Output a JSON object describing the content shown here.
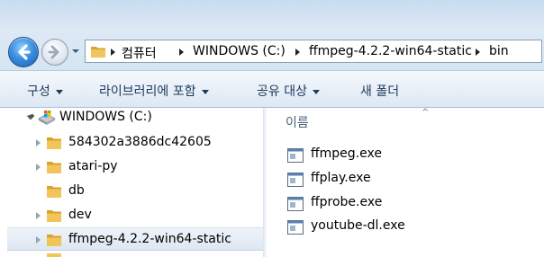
{
  "address_bar": {
    "breadcrumbs": [
      {
        "label": "컴퓨터"
      },
      {
        "label": "WINDOWS (C:)"
      },
      {
        "label": "ffmpeg-4.2.2-win64-static"
      },
      {
        "label": "bin"
      }
    ]
  },
  "command_bar": {
    "organize": "구성",
    "library": "라이브러리에 포함",
    "share": "공유 대상",
    "new_folder": "새 폴더"
  },
  "tree": {
    "drive": "WINDOWS (C:)",
    "items": [
      {
        "label": "584302a3886dc42605"
      },
      {
        "label": "atari-py"
      },
      {
        "label": "db"
      },
      {
        "label": "dev"
      },
      {
        "label": "ffmpeg-4.2.2-win64-static"
      }
    ]
  },
  "content": {
    "column_header": "이름",
    "files": [
      {
        "name": "ffmpeg.exe"
      },
      {
        "name": "ffplay.exe"
      },
      {
        "name": "ffprobe.exe"
      },
      {
        "name": "youtube-dl.exe"
      }
    ]
  },
  "colors": {
    "folder": "#e8b436",
    "accent": "#1e395b",
    "selection": "#dde7f2"
  }
}
